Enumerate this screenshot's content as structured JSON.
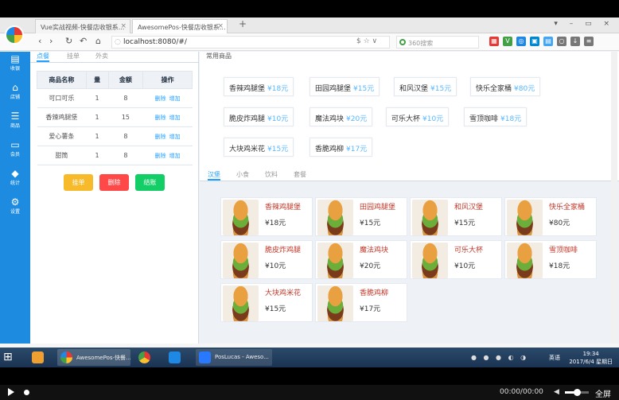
{
  "browser": {
    "tabs": [
      {
        "title": "Vue实战视频-快餐店收银系..."
      },
      {
        "title": "AwesomePos-快餐店收银系..."
      }
    ],
    "url": "localhost:8080/#/",
    "search_placeholder": "360搜索"
  },
  "nav": [
    {
      "label": "收银",
      "icon": "▤"
    },
    {
      "label": "店铺",
      "icon": "⌂"
    },
    {
      "label": "商品",
      "icon": "☰"
    },
    {
      "label": "会员",
      "icon": "▭"
    },
    {
      "label": "统计",
      "icon": "◆"
    },
    {
      "label": "设置",
      "icon": "⚙"
    }
  ],
  "order": {
    "tabs": [
      "点餐",
      "挂单",
      "外卖"
    ],
    "headers": [
      "商品名称",
      "量",
      "金额",
      "操作"
    ],
    "rows": [
      {
        "name": "可口可乐",
        "qty": "1",
        "price": "8"
      },
      {
        "name": "香辣鸡腿堡",
        "qty": "1",
        "price": "15"
      },
      {
        "name": "爱心薯条",
        "qty": "1",
        "price": "8"
      },
      {
        "name": "甜筒",
        "qty": "1",
        "price": "8"
      }
    ],
    "op_delete": "删除",
    "op_add": "增加",
    "buttons": {
      "hang": "挂单",
      "delete": "删除",
      "checkout": "结账"
    }
  },
  "goods": {
    "often_title": "常用商品",
    "often": [
      {
        "name": "香辣鸡腿堡",
        "price": "¥18元"
      },
      {
        "name": "田园鸡腿堡",
        "price": "¥15元"
      },
      {
        "name": "和风汉堡",
        "price": "¥15元"
      },
      {
        "name": "快乐全家桶",
        "price": "¥80元"
      },
      {
        "name": "脆皮炸鸡腿",
        "price": "¥10元"
      },
      {
        "name": "魔法鸡块",
        "price": "¥20元"
      },
      {
        "name": "可乐大杯",
        "price": "¥10元"
      },
      {
        "name": "雪顶咖啡",
        "price": "¥18元"
      },
      {
        "name": "大块鸡米花",
        "price": "¥15元"
      },
      {
        "name": "香脆鸡柳",
        "price": "¥17元"
      }
    ],
    "tabs": [
      "汉堡",
      "小食",
      "饮料",
      "套餐"
    ],
    "list": [
      {
        "name": "香辣鸡腿堡",
        "price": "¥18元"
      },
      {
        "name": "田园鸡腿堡",
        "price": "¥15元"
      },
      {
        "name": "和风汉堡",
        "price": "¥15元"
      },
      {
        "name": "快乐全家桶",
        "price": "¥80元"
      },
      {
        "name": "脆皮炸鸡腿",
        "price": "¥10元"
      },
      {
        "name": "魔法鸡块",
        "price": "¥20元"
      },
      {
        "name": "可乐大杯",
        "price": "¥10元"
      },
      {
        "name": "雪顶咖啡",
        "price": "¥18元"
      },
      {
        "name": "大块鸡米花",
        "price": "¥15元"
      },
      {
        "name": "香脆鸡柳",
        "price": "¥17元"
      }
    ]
  },
  "taskbar": {
    "items": [
      {
        "label": "AwesomePos-快餐..."
      },
      {
        "label": "PosLucas - Aweso..."
      }
    ],
    "ime": "英语",
    "time": "19:34",
    "date": "2017/6/4 星期日"
  },
  "video": {
    "time": "00:00/00:00",
    "fullscreen": "全屏",
    "volume_level": 0.5
  },
  "colors": {
    "nav": "#1d8ce0",
    "accent": "#20a0ff",
    "price": "#58b7ff",
    "hang": "#f7ba2a",
    "delete": "#ff4949",
    "checkout": "#13ce66"
  }
}
